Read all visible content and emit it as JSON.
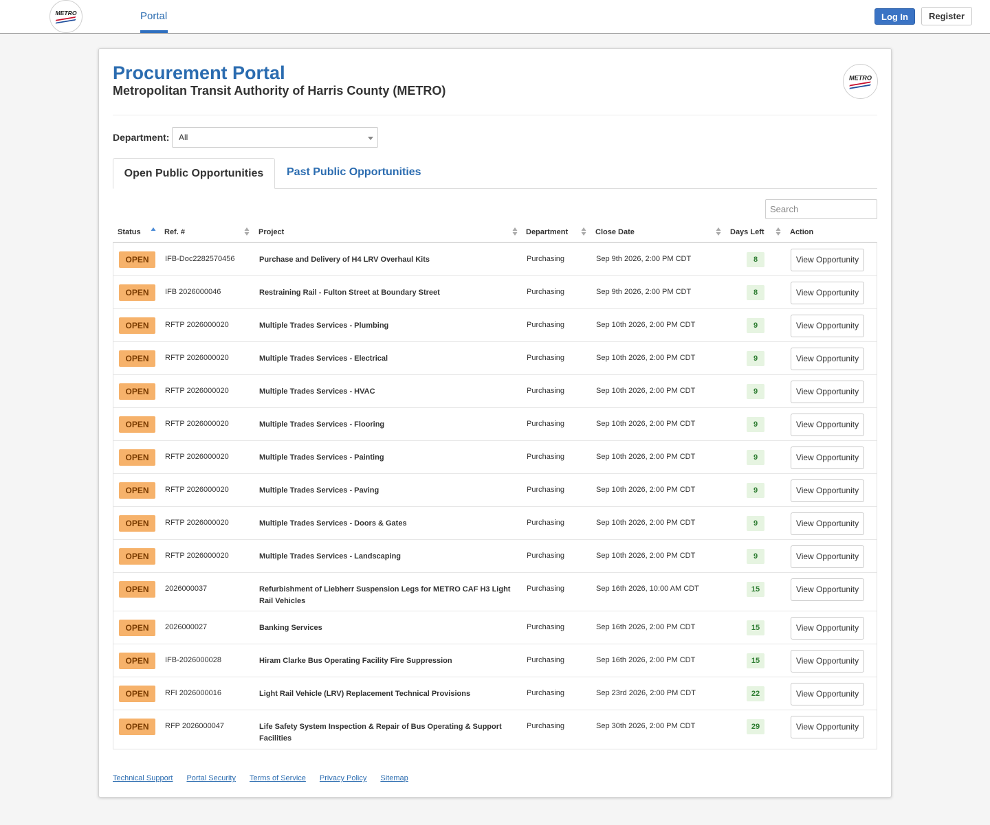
{
  "nav": {
    "logo_text": "METRO",
    "portal_label": "Portal",
    "login_label": "Log In",
    "register_label": "Register"
  },
  "header": {
    "title": "Procurement Portal",
    "subtitle": "Metropolitan Transit Authority of Harris County (METRO)"
  },
  "filter": {
    "department_label": "Department:",
    "department_value": "All"
  },
  "tabs": [
    {
      "label": "Open Public Opportunities",
      "active": true
    },
    {
      "label": "Past Public Opportunities",
      "active": false
    }
  ],
  "search": {
    "placeholder": "Search"
  },
  "table": {
    "columns": [
      "Status",
      "Ref. #",
      "Project",
      "Department",
      "Close Date",
      "Days Left",
      "Action"
    ],
    "rows": [
      {
        "status": "OPEN",
        "ref": "IFB-Doc2282570456",
        "project": "Purchase and Delivery of H4 LRV Overhaul Kits",
        "department": "Purchasing",
        "close_date": "Sep 9th 2026, 2:00 PM CDT",
        "days_left": "8",
        "action": "View Opportunity"
      },
      {
        "status": "OPEN",
        "ref": "IFB 2026000046",
        "project": "Restraining Rail - Fulton Street at Boundary Street",
        "department": "Purchasing",
        "close_date": "Sep 9th 2026, 2:00 PM CDT",
        "days_left": "8",
        "action": "View Opportunity"
      },
      {
        "status": "OPEN",
        "ref": "RFTP 2026000020",
        "project": "Multiple Trades Services - Plumbing",
        "department": "Purchasing",
        "close_date": "Sep 10th 2026, 2:00 PM CDT",
        "days_left": "9",
        "action": "View Opportunity"
      },
      {
        "status": "OPEN",
        "ref": "RFTP 2026000020",
        "project": "Multiple Trades Services - Electrical",
        "department": "Purchasing",
        "close_date": "Sep 10th 2026, 2:00 PM CDT",
        "days_left": "9",
        "action": "View Opportunity"
      },
      {
        "status": "OPEN",
        "ref": "RFTP 2026000020",
        "project": "Multiple Trades Services - HVAC",
        "department": "Purchasing",
        "close_date": "Sep 10th 2026, 2:00 PM CDT",
        "days_left": "9",
        "action": "View Opportunity"
      },
      {
        "status": "OPEN",
        "ref": "RFTP 2026000020",
        "project": "Multiple Trades Services - Flooring",
        "department": "Purchasing",
        "close_date": "Sep 10th 2026, 2:00 PM CDT",
        "days_left": "9",
        "action": "View Opportunity"
      },
      {
        "status": "OPEN",
        "ref": "RFTP 2026000020",
        "project": "Multiple Trades Services - Painting",
        "department": "Purchasing",
        "close_date": "Sep 10th 2026, 2:00 PM CDT",
        "days_left": "9",
        "action": "View Opportunity"
      },
      {
        "status": "OPEN",
        "ref": "RFTP 2026000020",
        "project": "Multiple Trades Services - Paving",
        "department": "Purchasing",
        "close_date": "Sep 10th 2026, 2:00 PM CDT",
        "days_left": "9",
        "action": "View Opportunity"
      },
      {
        "status": "OPEN",
        "ref": "RFTP 2026000020",
        "project": "Multiple Trades Services - Doors & Gates",
        "department": "Purchasing",
        "close_date": "Sep 10th 2026, 2:00 PM CDT",
        "days_left": "9",
        "action": "View Opportunity"
      },
      {
        "status": "OPEN",
        "ref": "RFTP 2026000020",
        "project": "Multiple Trades Services - Landscaping",
        "department": "Purchasing",
        "close_date": "Sep 10th 2026, 2:00 PM CDT",
        "days_left": "9",
        "action": "View Opportunity"
      },
      {
        "status": "OPEN",
        "ref": "2026000037",
        "project": "Refurbishment of Liebherr Suspension Legs for METRO CAF H3 Light Rail Vehicles",
        "department": "Purchasing",
        "close_date": "Sep 16th 2026, 10:00 AM CDT",
        "days_left": "15",
        "action": "View Opportunity"
      },
      {
        "status": "OPEN",
        "ref": "2026000027",
        "project": "Banking Services",
        "department": "Purchasing",
        "close_date": "Sep 16th 2026, 2:00 PM CDT",
        "days_left": "15",
        "action": "View Opportunity"
      },
      {
        "status": "OPEN",
        "ref": "IFB-2026000028",
        "project": "Hiram Clarke Bus Operating Facility Fire Suppression",
        "department": "Purchasing",
        "close_date": "Sep 16th 2026, 2:00 PM CDT",
        "days_left": "15",
        "action": "View Opportunity"
      },
      {
        "status": "OPEN",
        "ref": "RFI 2026000016",
        "project": "Light Rail Vehicle (LRV) Replacement Technical Provisions",
        "department": "Purchasing",
        "close_date": "Sep 23rd 2026, 2:00 PM CDT",
        "days_left": "22",
        "action": "View Opportunity"
      },
      {
        "status": "OPEN",
        "ref": "RFP 2026000047",
        "project": "Life Safety System Inspection & Repair of Bus Operating & Support Facilities",
        "department": "Purchasing",
        "close_date": "Sep 30th 2026, 2:00 PM CDT",
        "days_left": "29",
        "action": "View Opportunity"
      }
    ]
  },
  "footer": {
    "links": [
      "Technical Support",
      "Portal Security",
      "Terms of Service",
      "Privacy Policy",
      "Sitemap"
    ]
  },
  "colors": {
    "brand_blue": "#2b6cb0",
    "open_badge": "#f6b26b",
    "days_badge_bg": "#e6f4e1",
    "days_badge_text": "#2e7d32"
  },
  "icons": {
    "logo": "metro-logo-icon",
    "sort": "sort-arrows-icon",
    "sort_asc": "sort-asc-icon",
    "dropdown": "chevron-down-icon"
  }
}
